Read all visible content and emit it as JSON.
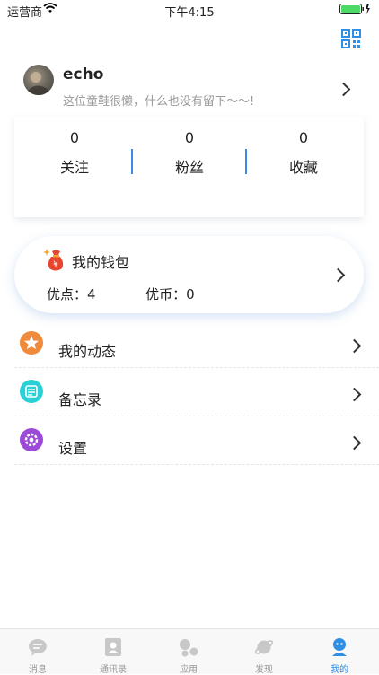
{
  "status_bar": {
    "carrier": "运营商",
    "time": "下午4:15"
  },
  "profile": {
    "name": "echo",
    "signature": "这位童鞋很懒，什么也没有留下～～!"
  },
  "stats": [
    {
      "value": "0",
      "label": "关注"
    },
    {
      "value": "0",
      "label": "粉丝"
    },
    {
      "value": "0",
      "label": "收藏"
    }
  ],
  "wallet": {
    "title": "我的钱包",
    "points_label": "优点：",
    "points_value": "4",
    "coins_label": "优币：",
    "coins_value": "0"
  },
  "menu": [
    {
      "label": "我的动态",
      "icon": "star-icon",
      "color": "#f08a3c"
    },
    {
      "label": "备忘录",
      "icon": "memo-icon",
      "color": "#2bd0d6"
    },
    {
      "label": "设置",
      "icon": "gear-icon",
      "color": "#9b4bd8"
    }
  ],
  "tabbar": [
    {
      "label": "消息",
      "icon": "chat-icon",
      "active": false
    },
    {
      "label": "通讯录",
      "icon": "contacts-icon",
      "active": false
    },
    {
      "label": "应用",
      "icon": "apps-icon",
      "active": false
    },
    {
      "label": "发现",
      "icon": "planet-icon",
      "active": false
    },
    {
      "label": "我的",
      "icon": "profile-icon",
      "active": true
    }
  ],
  "colors": {
    "accent": "#2e8fe4",
    "divider": "#3b8be0",
    "inactive": "#c8c8c8"
  }
}
